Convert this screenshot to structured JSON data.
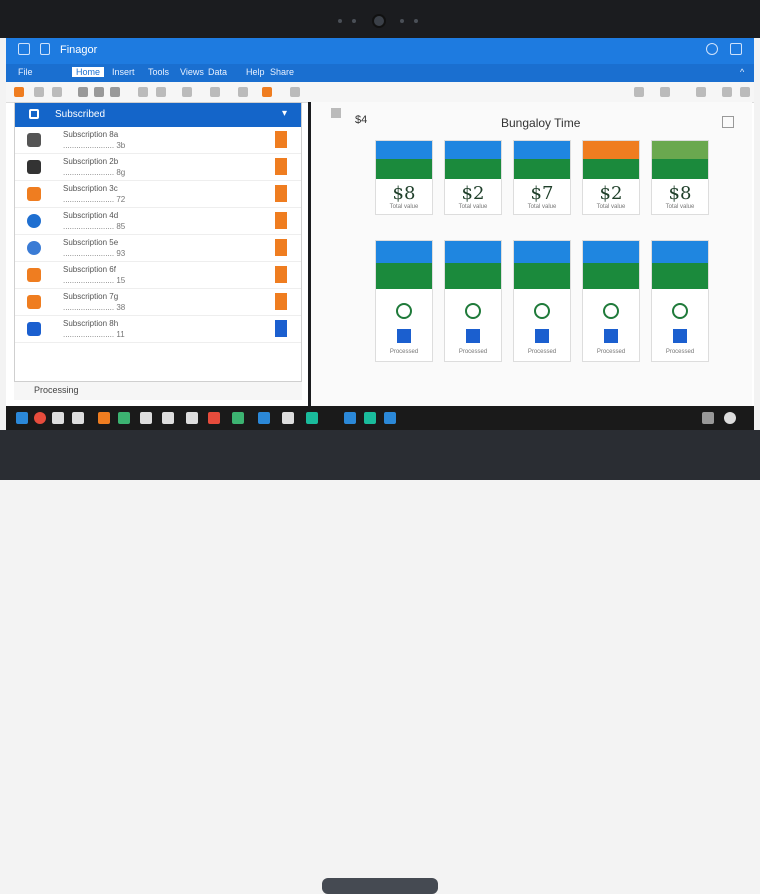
{
  "window": {
    "title": "Finagor",
    "icons": [
      "app-icon",
      "pin-icon"
    ],
    "controls": [
      "help-icon",
      "window-icon"
    ]
  },
  "ribbon_tabs": [
    "File",
    "Home",
    "Insert",
    "Tools",
    "Views",
    "Data",
    "Help",
    "Share"
  ],
  "left_panel": {
    "title": "Subscribed",
    "items": [
      {
        "title": "Subscription 8a",
        "text": "....................... 3b",
        "icon_color": "#555555"
      },
      {
        "title": "Subscription 2b",
        "text": "....................... 8g",
        "icon_color": "#333333"
      },
      {
        "title": "Subscription 3c",
        "text": "....................... 72",
        "icon_color": "#ef7d20"
      },
      {
        "title": "Subscription 4d",
        "text": "....................... 85",
        "icon_color": "#1f6fd0"
      },
      {
        "title": "Subscription 5e",
        "text": "....................... 93",
        "icon_color": "#3a7bd5"
      },
      {
        "title": "Subscription 6f",
        "text": "....................... 15",
        "icon_color": "#ef7d20"
      },
      {
        "title": "Subscription 7g",
        "text": "....................... 38",
        "icon_color": "#ef7d20"
      },
      {
        "title": "Subscription 8h",
        "text": "....................... 11",
        "icon_color": "#1b5fcf"
      }
    ],
    "status": "Processing"
  },
  "right_panel": {
    "title": "Bungaloy Time",
    "tiles_top": [
      {
        "top": "#1f86e0",
        "bottom": "#1b8a3c",
        "value": "$8",
        "caption": "Total value"
      },
      {
        "top": "#1f86e0",
        "bottom": "#1b8a3c",
        "value": "$2",
        "caption": "Total value"
      },
      {
        "top": "#1f86e0",
        "bottom": "#1b8a3c",
        "value": "$7",
        "caption": "Total value"
      },
      {
        "top": "#ef7d20",
        "bottom": "#1b8a3c",
        "value": "$2",
        "caption": "Total value"
      },
      {
        "top": "#6aa84f",
        "bottom": "#1b8a3c",
        "value": "$8",
        "caption": "Total value"
      }
    ],
    "tiles_bottom": [
      {
        "top": "#1f86e0",
        "bottom": "#1b8a3c",
        "caption": "Processed"
      },
      {
        "top": "#1f86e0",
        "bottom": "#1b8a3c",
        "caption": "Processed"
      },
      {
        "top": "#1f86e0",
        "bottom": "#1b8a3c",
        "caption": "Processed"
      },
      {
        "top": "#1f86e0",
        "bottom": "#1b8a3c",
        "caption": "Processed"
      },
      {
        "top": "#1f86e0",
        "bottom": "#1b8a3c",
        "caption": "Processed"
      }
    ]
  },
  "taskbar": {
    "icons": [
      "start",
      "search",
      "mail",
      "store",
      "edge",
      "photos",
      "settings",
      "files",
      "browser"
    ]
  }
}
